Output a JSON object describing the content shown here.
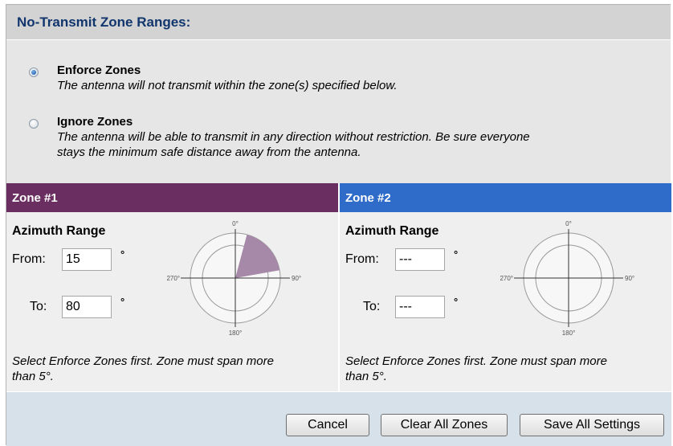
{
  "header": {
    "title": "No-Transmit Zone Ranges:"
  },
  "modes": [
    {
      "label": "Enforce Zones",
      "description": "The antenna will not transmit within the zone(s) specified below.",
      "checked": true
    },
    {
      "label": "Ignore Zones",
      "description_line1": "The antenna will be able to transmit in any direction without restriction. Be sure everyone",
      "description_line2": "stays the minimum safe distance away from the antenna.",
      "checked": false
    }
  ],
  "zones": [
    {
      "title": "Zone #1",
      "header_color": "#6a2f60",
      "azimuth_title": "Azimuth Range",
      "from_label": "From:",
      "from_value": "15",
      "to_label": "To:",
      "to_value": "80",
      "degree_symbol": "°",
      "dial": {
        "north": "0°",
        "east": "90°",
        "south": "180°",
        "west": "270°",
        "sector_from": 15,
        "sector_to": 80,
        "sector_color": "#a688a8"
      },
      "note": "Select Enforce Zones first. Zone must span more than 5°."
    },
    {
      "title": "Zone #2",
      "header_color": "#2f6cc9",
      "azimuth_title": "Azimuth Range",
      "from_label": "From:",
      "from_value": "---",
      "to_label": "To:",
      "to_value": "---",
      "degree_symbol": "°",
      "dial": {
        "north": "0°",
        "east": "90°",
        "south": "180°",
        "west": "270°"
      },
      "note": "Select Enforce Zones first. Zone must span more than 5°."
    }
  ],
  "buttons": {
    "cancel": "Cancel",
    "clear_all": "Clear All Zones",
    "save_all": "Save All Settings"
  }
}
